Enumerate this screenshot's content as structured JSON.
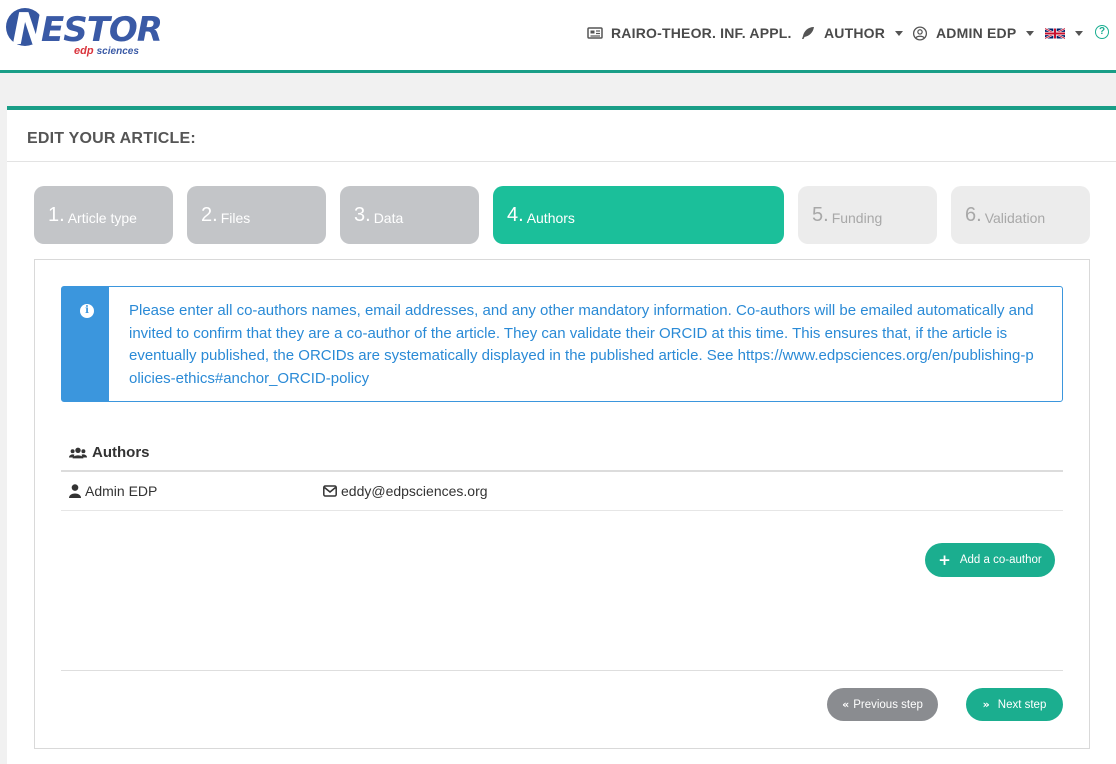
{
  "logo": {
    "letter": "N",
    "rest": "ESTOR",
    "brand_red": "edp",
    "brand_blue": "sciences"
  },
  "nav": {
    "journal": {
      "label": "RAIRO-THEOR. INF. APPL.",
      "icon": "newspaper-icon"
    },
    "role": {
      "label": "AUTHOR",
      "icon": "feather-icon"
    },
    "user": {
      "label": "ADMIN EDP",
      "icon": "user-circle-icon"
    },
    "language": {
      "icon": "uk-flag-icon"
    },
    "help": {
      "glyph": "?",
      "icon": "help-icon"
    }
  },
  "page": {
    "title": "EDIT YOUR ARTICLE:"
  },
  "steps": [
    {
      "num": "1.",
      "label": "Article type",
      "state": "done"
    },
    {
      "num": "2.",
      "label": "Files",
      "state": "done"
    },
    {
      "num": "3.",
      "label": "Data",
      "state": "done"
    },
    {
      "num": "4.",
      "label": "Authors",
      "state": "active"
    },
    {
      "num": "5.",
      "label": "Funding",
      "state": "future"
    },
    {
      "num": "6.",
      "label": "Validation",
      "state": "future"
    }
  ],
  "alert": {
    "text": "Please enter all co-authors names, email addresses, and any other mandatory information. Co-authors will be emailed automatically and invited to confirm that they are a co-author of the article. They can validate their ORCID at this time. This ensures that, if the article is eventually published, the ORCIDs are systematically displayed in the published article. See ",
    "link": "https://www.edpsciences.org/en/publishing-policies-ethics#anchor_ORCID-policy"
  },
  "authors": {
    "heading": "Authors",
    "rows": [
      {
        "name": "Admin EDP",
        "email": "eddy@edpsciences.org"
      }
    ],
    "add_label": "Add a co-author"
  },
  "footer": {
    "prev_label": "Previous step",
    "next_label": "Next step"
  },
  "colors": {
    "accent": "#1bbf9a",
    "teal_border": "#1a9e87",
    "info": "#3b96dd",
    "done_step": "#c3c5c8",
    "future_step": "#ececec",
    "prev_button": "#8a8c90"
  }
}
